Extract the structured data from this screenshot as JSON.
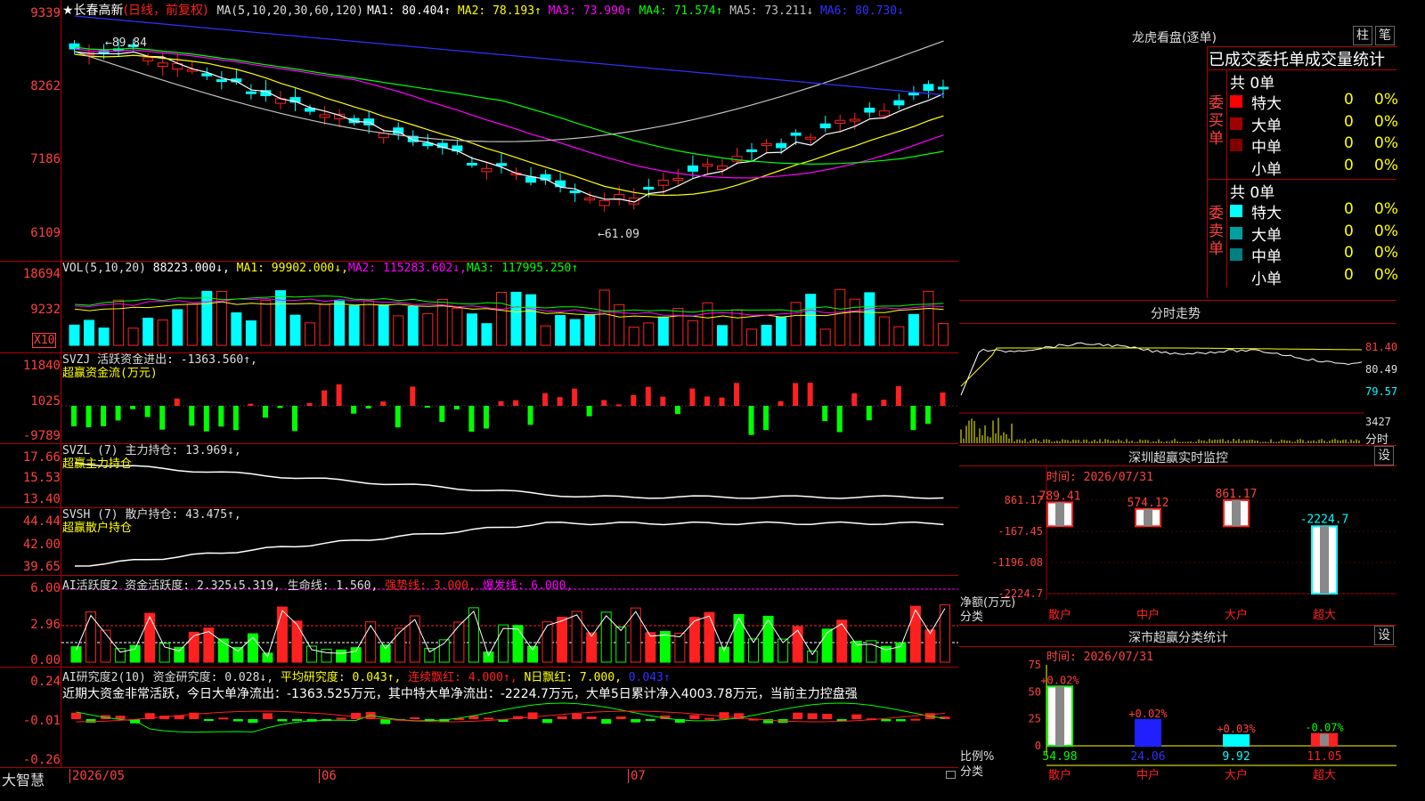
{
  "main": {
    "stock_title": "★长春高新",
    "mode": "(日线，前复权)",
    "ma_label": "MA(5,10,20,30,60,120)",
    "ma": [
      {
        "name": "MA1",
        "value": "80.404↑",
        "color": "#ffffff"
      },
      {
        "name": "MA2",
        "value": "78.193↑",
        "color": "#ffff00"
      },
      {
        "name": "MA3",
        "value": "73.990↑",
        "color": "#ff00ff"
      },
      {
        "name": "MA4",
        "value": "71.574↑",
        "color": "#00ff00"
      },
      {
        "name": "MA5",
        "value": "73.211↓",
        "color": "#c0c0c0"
      },
      {
        "name": "MA6",
        "value": "80.730↓",
        "color": "#3030ff"
      }
    ],
    "yticks": [
      "9339",
      "8262",
      "7186",
      "6109"
    ],
    "high_mark": "←89.84",
    "low_mark": "←61.09"
  },
  "vol": {
    "label": "VOL(5,10,20)",
    "value": "88223.000↓,",
    "ma": [
      {
        "name": "MA1",
        "value": "99902.000↓,",
        "color": "#ffff00"
      },
      {
        "name": "MA2",
        "value": "115283.602↓,",
        "color": "#ff00ff"
      },
      {
        "name": "MA3",
        "value": "117995.250↑",
        "color": "#00ff00"
      }
    ],
    "yticks": [
      "18694",
      "9232"
    ],
    "unit": "X10"
  },
  "svzj": {
    "line1": "SVZJ  活跃资金进出: -1363.560↑,",
    "line2": "超赢资金流(万元)",
    "yticks": [
      "11840",
      "1025",
      "-9789"
    ]
  },
  "svzl": {
    "line1": "SVZL (7) 主力持仓: 13.969↓,",
    "line2": "超赢主力持仓",
    "yticks": [
      "17.66",
      "15.53",
      "13.40"
    ]
  },
  "svsh": {
    "line1": "SVSH (7) 散户持仓: 43.475↑,",
    "line2": "超赢散户持仓",
    "yticks": [
      "44.44",
      "42.00",
      "39.65"
    ]
  },
  "ai1": {
    "label": "AI活跃度2 资金活跃度: 2.325↓",
    "v2": "5.319,",
    "v3": "生命线: 1.560,",
    "v4": "强势线: 3.000,",
    "v5": "爆发线: 6.000,",
    "yticks": [
      "6.00",
      "2.96",
      "0.00"
    ]
  },
  "ai2": {
    "label": "AI研究度2(10) 资金研究度: 0.028↓,",
    "v2": "平均研究度: 0.043↑,",
    "v3": "连续飘红: 4.000↑,",
    "v4": "N日飘红: 7.000,",
    "v5": "0.043↑",
    "summary": "近期大资金非常活跃，今日大单净流出：-1363.525万元，其中特大单净流出：-2224.7万元，大单5日累计净入4003.78万元，当前主力控盘强",
    "yticks": [
      "0.24",
      "-0.01",
      "-0.26"
    ]
  },
  "bottom": {
    "brand": "大智慧",
    "date_start": "2026/05",
    "m2": "06",
    "m3": "07"
  },
  "lhb": {
    "title": "龙虎看盘(逐单)",
    "btn1": "柱",
    "btn2": "笔",
    "header": "已成交委托单成交量统计",
    "buy_label": "委买单",
    "sell_label": "委卖单",
    "buy_total": "共 0单",
    "sell_total": "共 0单",
    "buy_rows": [
      {
        "name": "特大",
        "count": "0",
        "pct": "0%",
        "color": "#ff0000"
      },
      {
        "name": "大单",
        "count": "0",
        "pct": "0%",
        "color": "#a00000"
      },
      {
        "name": "中单",
        "count": "0",
        "pct": "0%",
        "color": "#800000"
      },
      {
        "name": "小单",
        "count": "0",
        "pct": "0%",
        "color": "#000000"
      }
    ],
    "sell_rows": [
      {
        "name": "特大",
        "count": "0",
        "pct": "0%",
        "color": "#00ffff"
      },
      {
        "name": "大单",
        "count": "0",
        "pct": "0%",
        "color": "#00a0a0"
      },
      {
        "name": "中单",
        "count": "0",
        "pct": "0%",
        "color": "#008080"
      },
      {
        "name": "小单",
        "count": "0",
        "pct": "0%",
        "color": "#000000"
      }
    ]
  },
  "fs": {
    "title": "分时走势",
    "yticks": [
      "81.40",
      "80.49",
      "79.57"
    ],
    "vol_tick": "3427",
    "vol_unit": "分时"
  },
  "monitor": {
    "title": "深圳超赢实时监控",
    "btn": "设",
    "time": "时间: 2026/07/31",
    "yticks": [
      "861.17",
      "-167.45",
      "-1196.08",
      "-2224.7"
    ],
    "ylabel": "净额(万元)",
    "xlabel": "分类",
    "bars": [
      {
        "cat": "散户",
        "value": 789.41,
        "label": "789.41"
      },
      {
        "cat": "中户",
        "value": 574.12,
        "label": "574.12"
      },
      {
        "cat": "大户",
        "value": 861.17,
        "label": "861.17"
      },
      {
        "cat": "超大",
        "value": -2224.7,
        "label": "-2224.7"
      }
    ]
  },
  "classify": {
    "title": "深市超赢分类统计",
    "btn": "设",
    "time": "时间: 2026/07/31",
    "yticks": [
      "75",
      "50",
      "25",
      "0"
    ],
    "ylabel": "比例%",
    "xlabel": "分类",
    "bars": [
      {
        "cat": "散户",
        "value": 54.98,
        "change": "+0.02%",
        "color": "#ffffff"
      },
      {
        "cat": "中户",
        "value": 24.06,
        "change": "+0.02%",
        "color": "#2020ff"
      },
      {
        "cat": "大户",
        "value": 9.92,
        "change": "+0.03%",
        "color": "#00ffff"
      },
      {
        "cat": "超大",
        "value": 11.05,
        "change": "-0.07%",
        "color": "#ff2020"
      }
    ],
    "values_text": [
      "54.98",
      "24.06",
      "9.92",
      "11.05"
    ]
  }
}
